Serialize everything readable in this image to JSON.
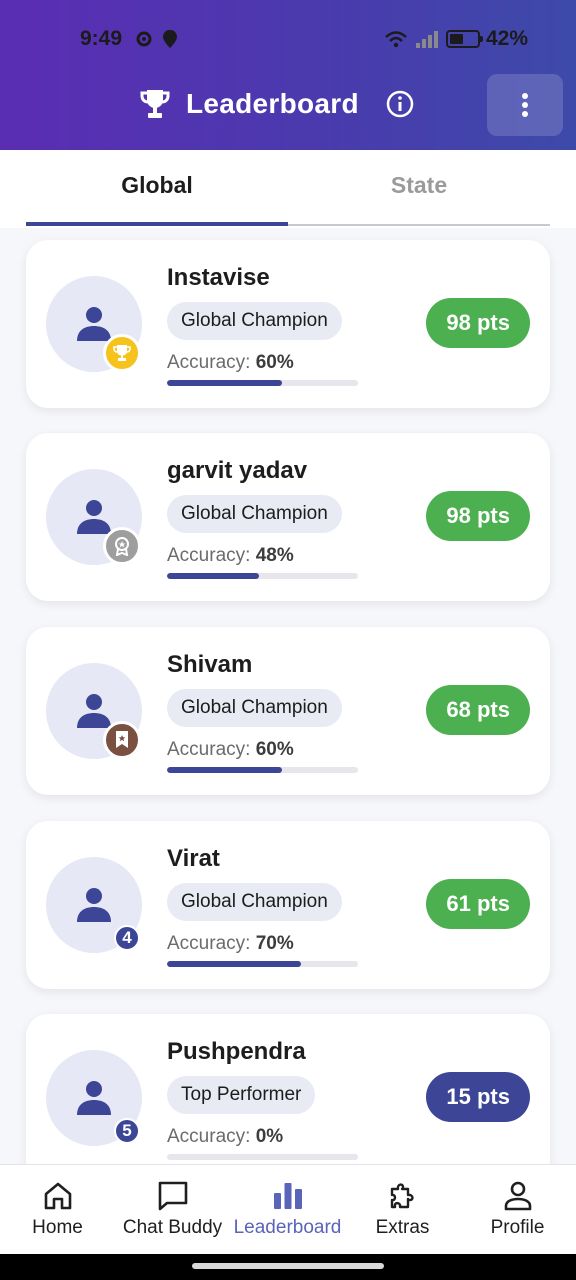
{
  "status_bar": {
    "time": "9:49",
    "battery": "42%",
    "battery_level": 0.42
  },
  "header": {
    "title": "Leaderboard"
  },
  "tabs": [
    {
      "label": "Global",
      "active": true
    },
    {
      "label": "State",
      "active": false
    }
  ],
  "leaders": [
    {
      "name": "Instavise",
      "title": "Global Champion",
      "accuracy_label": "Accuracy: ",
      "accuracy": "60%",
      "accuracy_value": 0.6,
      "points": "98 pts",
      "rank": 1,
      "badge": "trophy-icon",
      "badge_color": "#f6c21c",
      "points_color": "#4caf50"
    },
    {
      "name": "garvit yadav",
      "title": "Global Champion",
      "accuracy_label": "Accuracy: ",
      "accuracy": "48%",
      "accuracy_value": 0.48,
      "points": "98 pts",
      "rank": 2,
      "badge": "medal-icon",
      "badge_color": "#9e9e9e",
      "points_color": "#4caf50"
    },
    {
      "name": "Shivam",
      "title": "Global Champion",
      "accuracy_label": "Accuracy: ",
      "accuracy": "60%",
      "accuracy_value": 0.6,
      "points": "68 pts",
      "rank": 3,
      "badge": "ribbon-icon",
      "badge_color": "#7a5040",
      "points_color": "#4caf50"
    },
    {
      "name": "Virat",
      "title": "Global Champion",
      "accuracy_label": "Accuracy: ",
      "accuracy": "70%",
      "accuracy_value": 0.7,
      "points": "61 pts",
      "rank": "4",
      "badge": "rank-number",
      "points_color": "#4caf50"
    },
    {
      "name": "Pushpendra",
      "title": "Top Performer",
      "accuracy_label": "Accuracy: ",
      "accuracy": "0%",
      "accuracy_value": 0.0,
      "points": "15 pts",
      "rank": "5",
      "badge": "rank-number",
      "points_color": "#3c4596"
    }
  ],
  "bottom_nav": [
    {
      "label": "Home",
      "icon": "home-icon",
      "active": false
    },
    {
      "label": "Chat Buddy",
      "icon": "chat-icon",
      "active": false
    },
    {
      "label": "Leaderboard",
      "icon": "bar-chart-icon",
      "active": true
    },
    {
      "label": "Extras",
      "icon": "puzzle-icon",
      "active": false
    },
    {
      "label": "Profile",
      "icon": "person-icon",
      "active": false
    }
  ],
  "colors": {
    "accent": "#3c4596",
    "success": "#4caf50",
    "header_start": "#5b2db3",
    "header_end": "#3e4aa9"
  }
}
